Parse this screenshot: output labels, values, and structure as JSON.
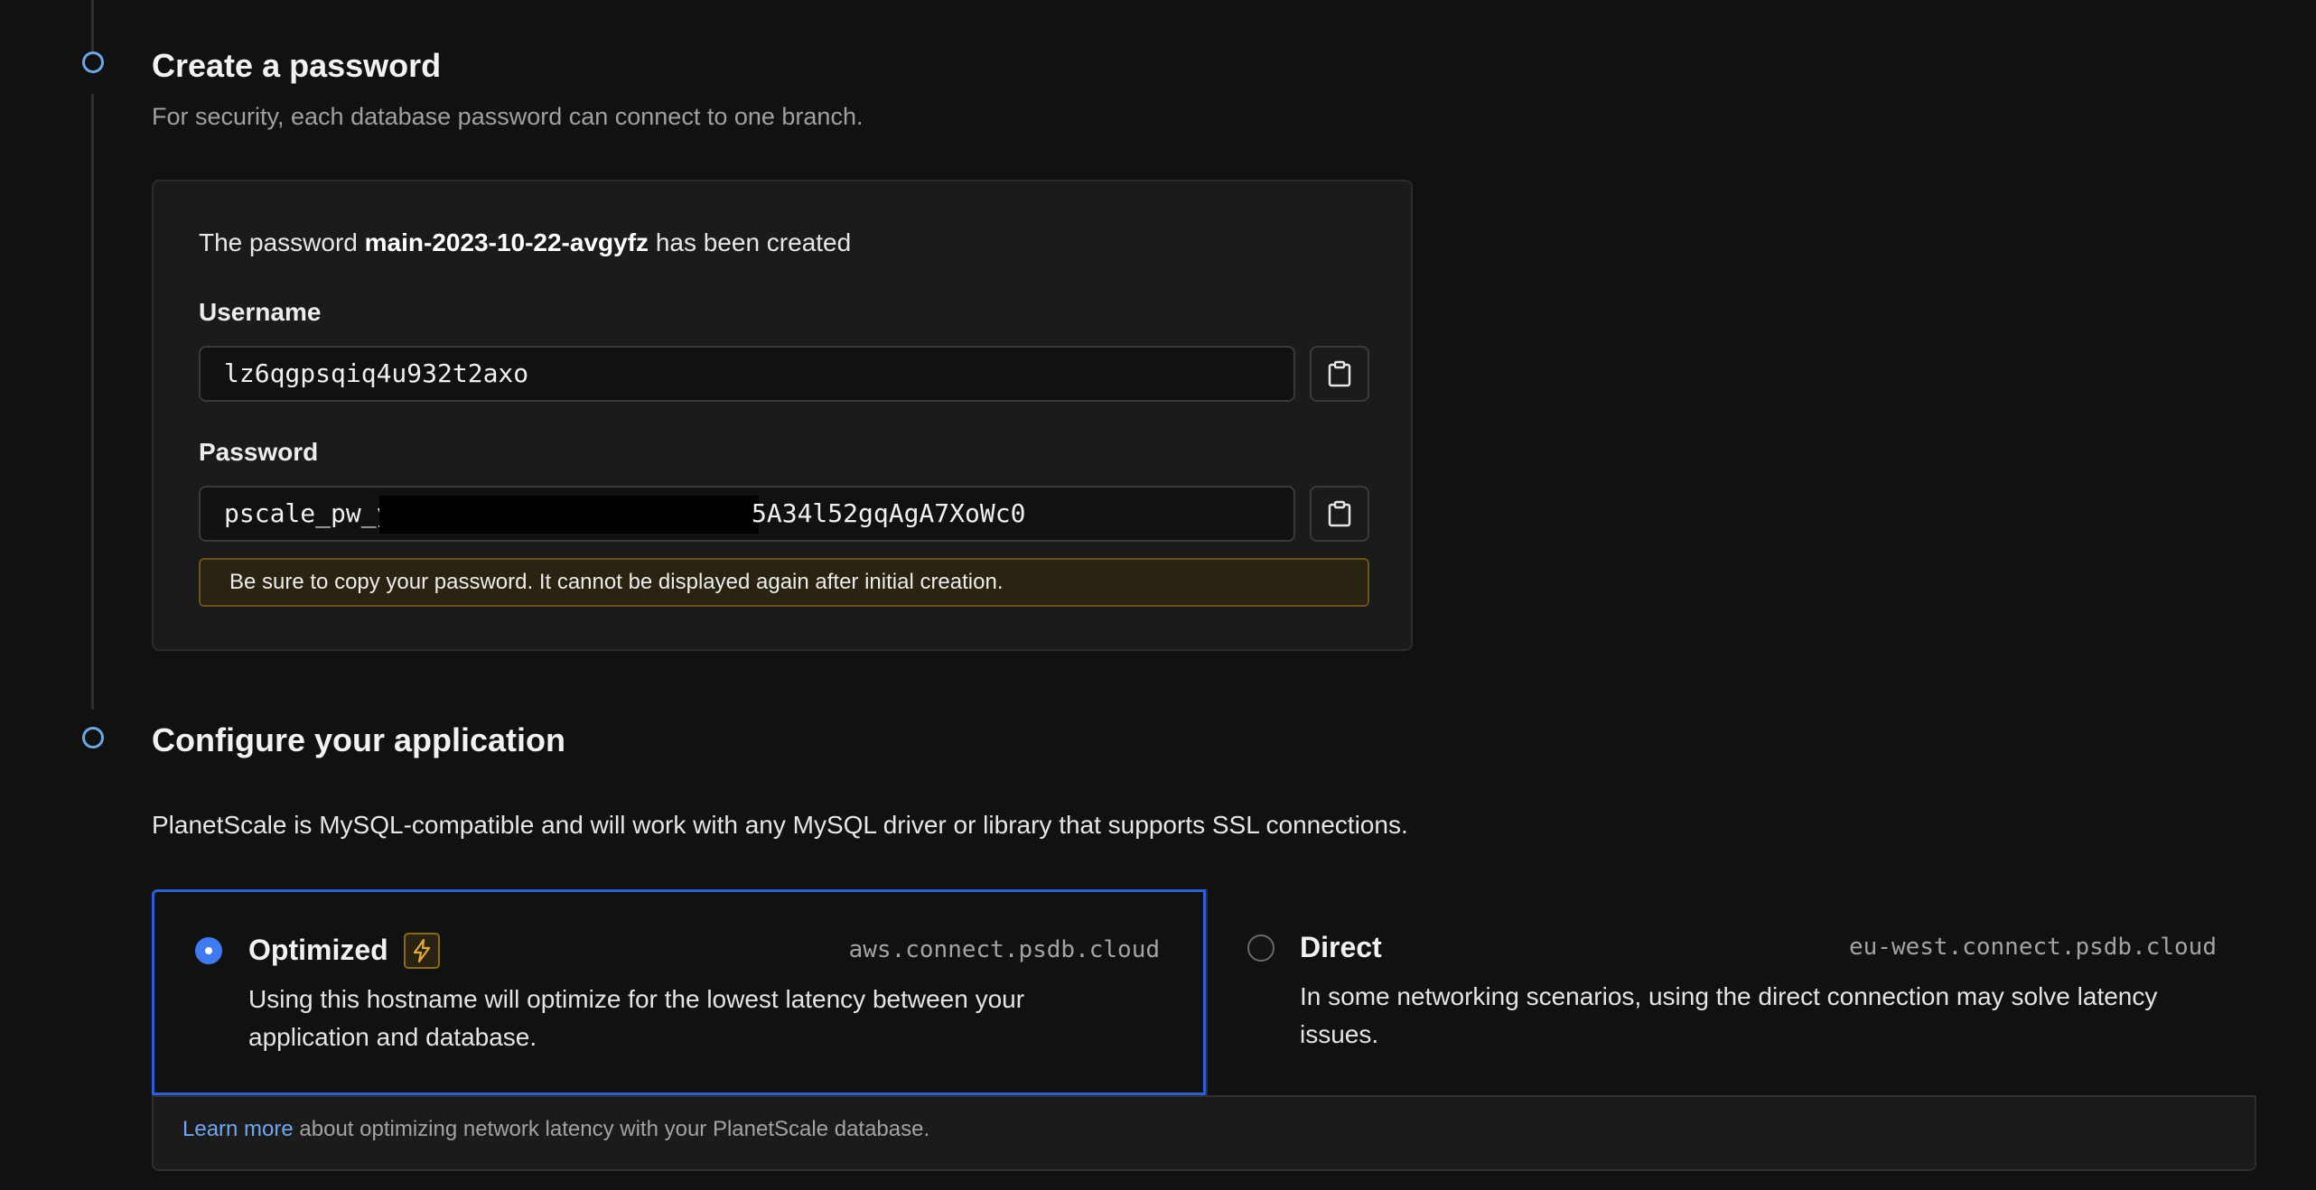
{
  "password_step": {
    "title": "Create a password",
    "description": "For security, each database password can connect to one branch.",
    "created_prefix": "The password",
    "password_name": "main-2023-10-22-avgyfz",
    "created_suffix": "has been created",
    "username_label": "Username",
    "username_value": "lz6qgpsqiq4u932t2axo",
    "password_label": "Password",
    "password_value_start": "pscale_pw_y",
    "password_value_end": "5A34l52gqAgA7XoWc0",
    "warning": "Be sure to copy your password. It cannot be displayed again after initial creation."
  },
  "config_step": {
    "title": "Configure your application",
    "intro": "PlanetScale is MySQL-compatible and will work with any MySQL driver or library that supports SSL connections.",
    "options": [
      {
        "title": "Optimized",
        "host": "aws.connect.psdb.cloud",
        "description": "Using this hostname will optimize for the lowest latency between your application and database.",
        "selected": true
      },
      {
        "title": "Direct",
        "host": "eu-west.connect.psdb.cloud",
        "description": "In some networking scenarios, using the direct connection may solve latency issues.",
        "selected": false
      }
    ],
    "footer_link": "Learn more",
    "footer_text": "about optimizing network latency with your PlanetScale database."
  },
  "colors": {
    "accent": "#3e7bf0",
    "timeline_dot": "#6fa7e6",
    "warning_bg": "#2a2311",
    "warning_border": "#6b5218",
    "link": "#6ea8f0"
  },
  "icons": {
    "copy": "clipboard-icon",
    "badge": "lightning-bolt-icon",
    "step": "step-circle-icon"
  }
}
